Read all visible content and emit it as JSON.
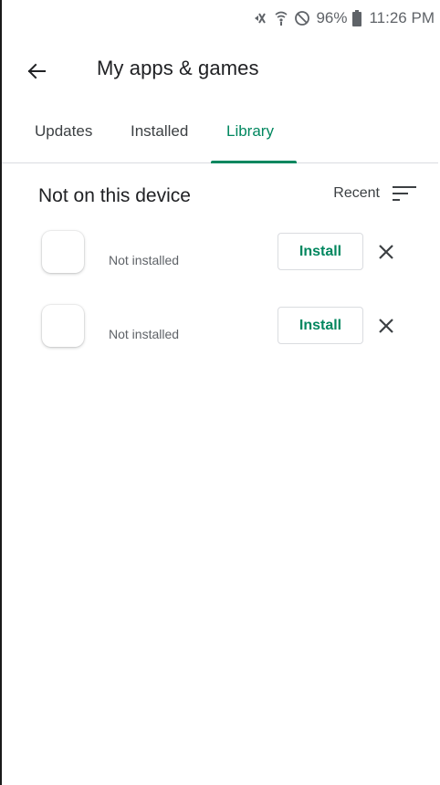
{
  "status_bar": {
    "icons": [
      "mute-vibrate-icon",
      "wifi-icon",
      "do-not-disturb-icon",
      "battery-icon"
    ],
    "battery": "96%",
    "time": "11:26 PM"
  },
  "app_bar": {
    "back_icon": "arrow-back-icon",
    "title": "My apps & games"
  },
  "tabs": [
    {
      "label": "Updates",
      "active": false
    },
    {
      "label": "Installed",
      "active": false
    },
    {
      "label": "Library",
      "active": true
    }
  ],
  "section": {
    "title": "Not on this device",
    "sort_label": "Recent",
    "sort_icon": "sort-icon"
  },
  "apps": [
    {
      "name": "",
      "status": "Not installed",
      "install_label": "Install",
      "remove_icon": "close-icon"
    },
    {
      "name": "",
      "status": "Not installed",
      "install_label": "Install",
      "remove_icon": "close-icon"
    }
  ],
  "colors": {
    "accent": "#01875f",
    "text_primary": "#202124",
    "text_secondary": "#5f6368",
    "divider": "#dadce0"
  }
}
